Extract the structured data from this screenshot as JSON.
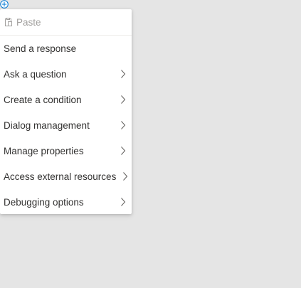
{
  "menu": {
    "paste_label": "Paste",
    "items": [
      {
        "label": "Send a response",
        "has_submenu": false
      },
      {
        "label": "Ask a question",
        "has_submenu": true
      },
      {
        "label": "Create a condition",
        "has_submenu": true
      },
      {
        "label": "Dialog management",
        "has_submenu": true
      },
      {
        "label": "Manage properties",
        "has_submenu": true
      },
      {
        "label": "Access external resources",
        "has_submenu": true
      },
      {
        "label": "Debugging options",
        "has_submenu": true
      }
    ]
  },
  "icons": {
    "add": "plus-icon",
    "paste": "clipboard-icon",
    "submenu": "chevron-right-icon"
  },
  "colors": {
    "accent": "#0078d4",
    "text": "#323130",
    "disabled": "#a19f9d",
    "background": "#e5e5e5"
  }
}
